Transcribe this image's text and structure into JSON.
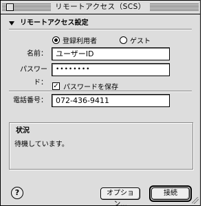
{
  "window": {
    "title": "リモートアクセス（SCS）"
  },
  "section": {
    "title": "リモートアクセス設定"
  },
  "login": {
    "registered_label": "登録利用者",
    "guest_label": "ゲスト",
    "name_label": "名前：",
    "name_value": "ユーザーID",
    "password_label": "パスワード：",
    "password_value": "••••••••",
    "save_password_label": "パスワードを保存",
    "phone_label": "電話番号：",
    "phone_value": "072-436-9411"
  },
  "status": {
    "title": "状況",
    "text": "待機しています。"
  },
  "buttons": {
    "options": "オプション...",
    "connect": "接続",
    "help": "?"
  }
}
